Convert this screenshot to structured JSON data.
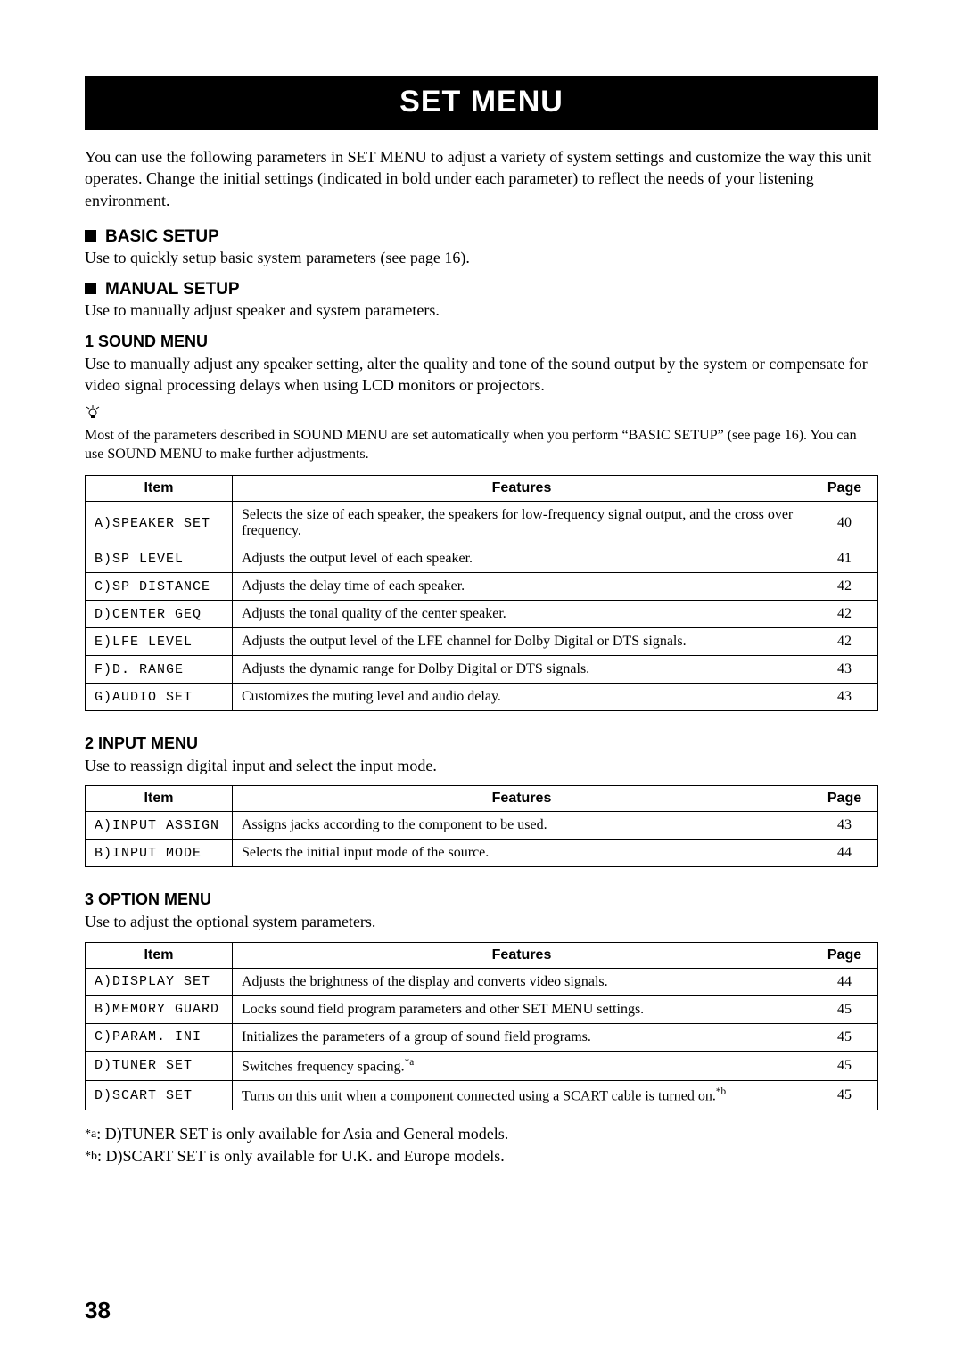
{
  "title": "SET MENU",
  "intro": "You can use the following parameters in SET MENU to adjust a variety of system settings and customize the way this unit operates. Change the initial settings (indicated in bold under each parameter) to reflect the needs of your listening environment.",
  "basic": {
    "heading": "BASIC SETUP",
    "desc": "Use to quickly setup basic system parameters (see page 16)."
  },
  "manual": {
    "heading": "MANUAL SETUP",
    "desc": "Use to manually adjust speaker and system parameters."
  },
  "sound": {
    "heading": "1 SOUND MENU",
    "desc": "Use to manually adjust any speaker setting, alter the quality and tone of the sound output by the system or compensate for video signal processing delays when using LCD monitors or projectors.",
    "hint": "Most of the parameters described in SOUND MENU are set automatically when you perform “BASIC SETUP” (see page 16). You can use SOUND MENU to make further adjustments."
  },
  "input": {
    "heading": "2 INPUT MENU",
    "desc": "Use to reassign digital input and select the input mode."
  },
  "option": {
    "heading": "3 OPTION MENU",
    "desc": "Use to adjust the optional system parameters."
  },
  "headers": {
    "item": "Item",
    "features": "Features",
    "page": "Page"
  },
  "sound_rows": [
    {
      "item": "A)SPEAKER SET",
      "feat": "Selects the size of each speaker, the speakers for low-frequency signal output, and the cross over frequency.",
      "page": "40"
    },
    {
      "item": "B)SP LEVEL",
      "feat": "Adjusts the output level of each speaker.",
      "page": "41"
    },
    {
      "item": "C)SP DISTANCE",
      "feat": "Adjusts the delay time of each speaker.",
      "page": "42"
    },
    {
      "item": "D)CENTER GEQ",
      "feat": "Adjusts the tonal quality of the center speaker.",
      "page": "42"
    },
    {
      "item": "E)LFE LEVEL",
      "feat": "Adjusts the output level of the LFE channel for Dolby Digital or DTS signals.",
      "page": "42"
    },
    {
      "item": "F)D. RANGE",
      "feat": "Adjusts the dynamic range for Dolby Digital or DTS signals.",
      "page": "43"
    },
    {
      "item": "G)AUDIO SET",
      "feat": "Customizes the muting level and audio delay.",
      "page": "43"
    }
  ],
  "input_rows": [
    {
      "item": "A)INPUT ASSIGN",
      "feat": "Assigns jacks according to the component to be used.",
      "page": "43"
    },
    {
      "item": "B)INPUT MODE",
      "feat": "Selects the initial input mode of the source.",
      "page": "44"
    }
  ],
  "option_rows": [
    {
      "item": "A)DISPLAY SET",
      "feat": "Adjusts the brightness of the display and converts video signals.",
      "page": "44"
    },
    {
      "item": "B)MEMORY GUARD",
      "feat": "Locks sound field program parameters and other SET MENU settings.",
      "page": "45"
    },
    {
      "item": "C)PARAM. INI",
      "feat": "Initializes the parameters of a group of sound field programs.",
      "page": "45"
    },
    {
      "item": "D)TUNER SET",
      "feat": "Switches frequency spacing.",
      "fn": "*a",
      "page": "45"
    },
    {
      "item": "D)SCART SET",
      "feat": "Turns on this unit when a component connected using a SCART cable is turned on.",
      "fn": "*b",
      "page": "45"
    }
  ],
  "footnotes": {
    "a_label": "*a",
    "a_text": ": D)TUNER SET is only available for Asia and General models.",
    "b_label": "*b",
    "b_text": ": D)SCART SET is only available for U.K. and Europe models."
  },
  "page_number": "38"
}
